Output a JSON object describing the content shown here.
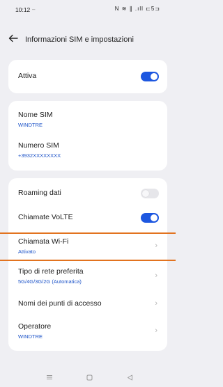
{
  "status": {
    "time": "10:12",
    "dot": "–",
    "icons": "N ≋ ∥ .ıll ⊏5⊐"
  },
  "header": {
    "title": "Informazioni SIM e impostazioni"
  },
  "active_card": {
    "label": "Attiva",
    "toggle_on": true
  },
  "sim_card": {
    "name_label": "Nome SIM",
    "name_value": "WINDTRE",
    "number_label": "Numero SIM",
    "number_value": "+3932XXXXXXXX"
  },
  "settings": {
    "roaming_label": "Roaming dati",
    "roaming_on": false,
    "volte_label": "Chiamate VoLTE",
    "volte_on": true,
    "wifi_call_label": "Chiamata Wi-Fi",
    "wifi_call_value": "Attivato",
    "network_label": "Tipo di rete preferita",
    "network_value": "5G/4G/3G/2G (Automatica)",
    "apn_label": "Nomi dei punti di accesso",
    "operator_label": "Operatore",
    "operator_value": "WINDTRE"
  },
  "colors": {
    "accent": "#1d57e0",
    "highlight": "#e2731f"
  },
  "icons": {
    "back": "arrow-left-icon",
    "chevron": "chevron-right-icon",
    "nav_menu": "menu-icon",
    "nav_home": "home-icon",
    "nav_back": "back-triangle-icon"
  }
}
